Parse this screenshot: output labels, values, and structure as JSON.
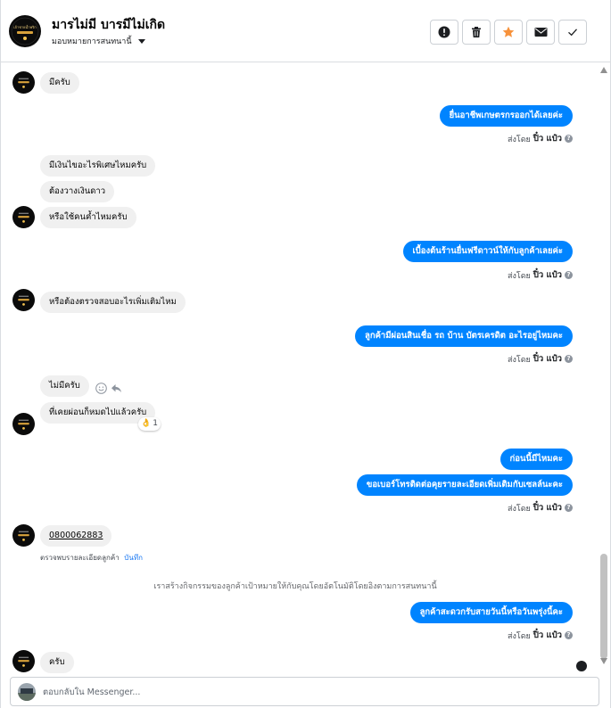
{
  "header": {
    "name": "มารไม่มี บารมีไม่เกิด",
    "assign_label": "มอบหมายการสนทนานี้",
    "avatar_text": "เจ้าชายน้ำพริก"
  },
  "icons": {
    "spam": "exclamation-circle-icon",
    "delete": "trash-icon",
    "star": "star-icon",
    "email": "envelope-icon",
    "done": "checkmark-icon"
  },
  "colors": {
    "accent": "#0084ff",
    "incoming_bg": "#f0f0f0",
    "star": "#f7923b"
  },
  "messages": [
    {
      "side": "in",
      "text": "มีครับ"
    },
    {
      "side": "out",
      "text": "ยื่นอาชีพเกษตรกรออกได้เลยค่ะ"
    },
    {
      "side": "in",
      "text": "มีเงินไขอะไรพิเศษไหมครับ"
    },
    {
      "side": "in",
      "text": "ต้องวางเงินดาว"
    },
    {
      "side": "in",
      "text": "หรือใช้คนค้ำไหมครับ"
    },
    {
      "side": "out",
      "text": "เบื้องต้นร้านยื่นฟรีดาวน์ให้กับลูกค้าเลยค่ะ"
    },
    {
      "side": "in",
      "text": "หรือต้องตรวจสอบอะไรเพิ่มเติมไหม"
    },
    {
      "side": "out",
      "text": "ลูกค้ามีผ่อนสินเชื่อ รถ บ้าน บัตรเครดิต อะไรอยู่ไหมคะ"
    },
    {
      "side": "in",
      "text": "ไม่มีครับ"
    },
    {
      "side": "in",
      "text": "ที่เคยผ่อนก็หมดไปแล้วครับ"
    },
    {
      "side": "out",
      "text": "ก่อนนี้มีไหมคะ"
    },
    {
      "side": "out",
      "text": "ขอเบอร์โทรติดต่อคุยรายละเอียดเพิ่มเติมกับเซลล์นะคะ"
    },
    {
      "side": "in",
      "text": "0800062883"
    },
    {
      "side": "out",
      "text": "ลูกค้าสะดวกรับสายวันนี้หรือวันพรุ่งนี้คะ"
    },
    {
      "side": "in",
      "text": "ครับ"
    }
  ],
  "sent_by": {
    "prefix": "ส่งโดย",
    "name": "ปิ๋ว แป๋ว",
    "help": "?"
  },
  "reaction": {
    "emoji": "👌",
    "count": "1"
  },
  "contact_note": {
    "text": "ตรวจพบรายละเอียดลูกค้า",
    "link": "บันทึก"
  },
  "system_note": "เราสร้างกิจกรรมของลูกค้าเป้าหมายให้กับคุณโดยอัตโนมัติโดยอิงตามการสนทนานี้",
  "composer": {
    "placeholder": "ตอบกลับใน Messenger..."
  }
}
